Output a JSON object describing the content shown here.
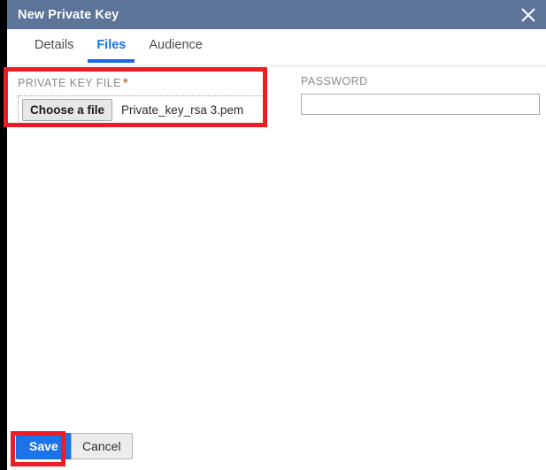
{
  "window": {
    "title": "New Private Key",
    "close_icon": "close-icon",
    "titlebar_color": "#5b7498"
  },
  "tabs": [
    {
      "label": "Details",
      "active": false
    },
    {
      "label": "Files",
      "active": true
    },
    {
      "label": "Audience",
      "active": false
    }
  ],
  "form": {
    "private_key_file": {
      "label": "PRIVATE KEY FILE",
      "required_marker": "*",
      "button_label": "Choose a file",
      "file_name": "Private_key_rsa 3.pem"
    },
    "password": {
      "label": "PASSWORD",
      "value": "",
      "placeholder": ""
    }
  },
  "footer": {
    "save_label": "Save",
    "cancel_label": "Cancel"
  },
  "annotations": {
    "color": "#ee1c25",
    "highlighted": [
      "private-key-file-field",
      "save-button"
    ]
  },
  "colors": {
    "accent_blue": "#1a73e8",
    "titlebar_blue": "#5b7498",
    "required_orange": "#c8732f",
    "annotation_red": "#ee1c25"
  }
}
